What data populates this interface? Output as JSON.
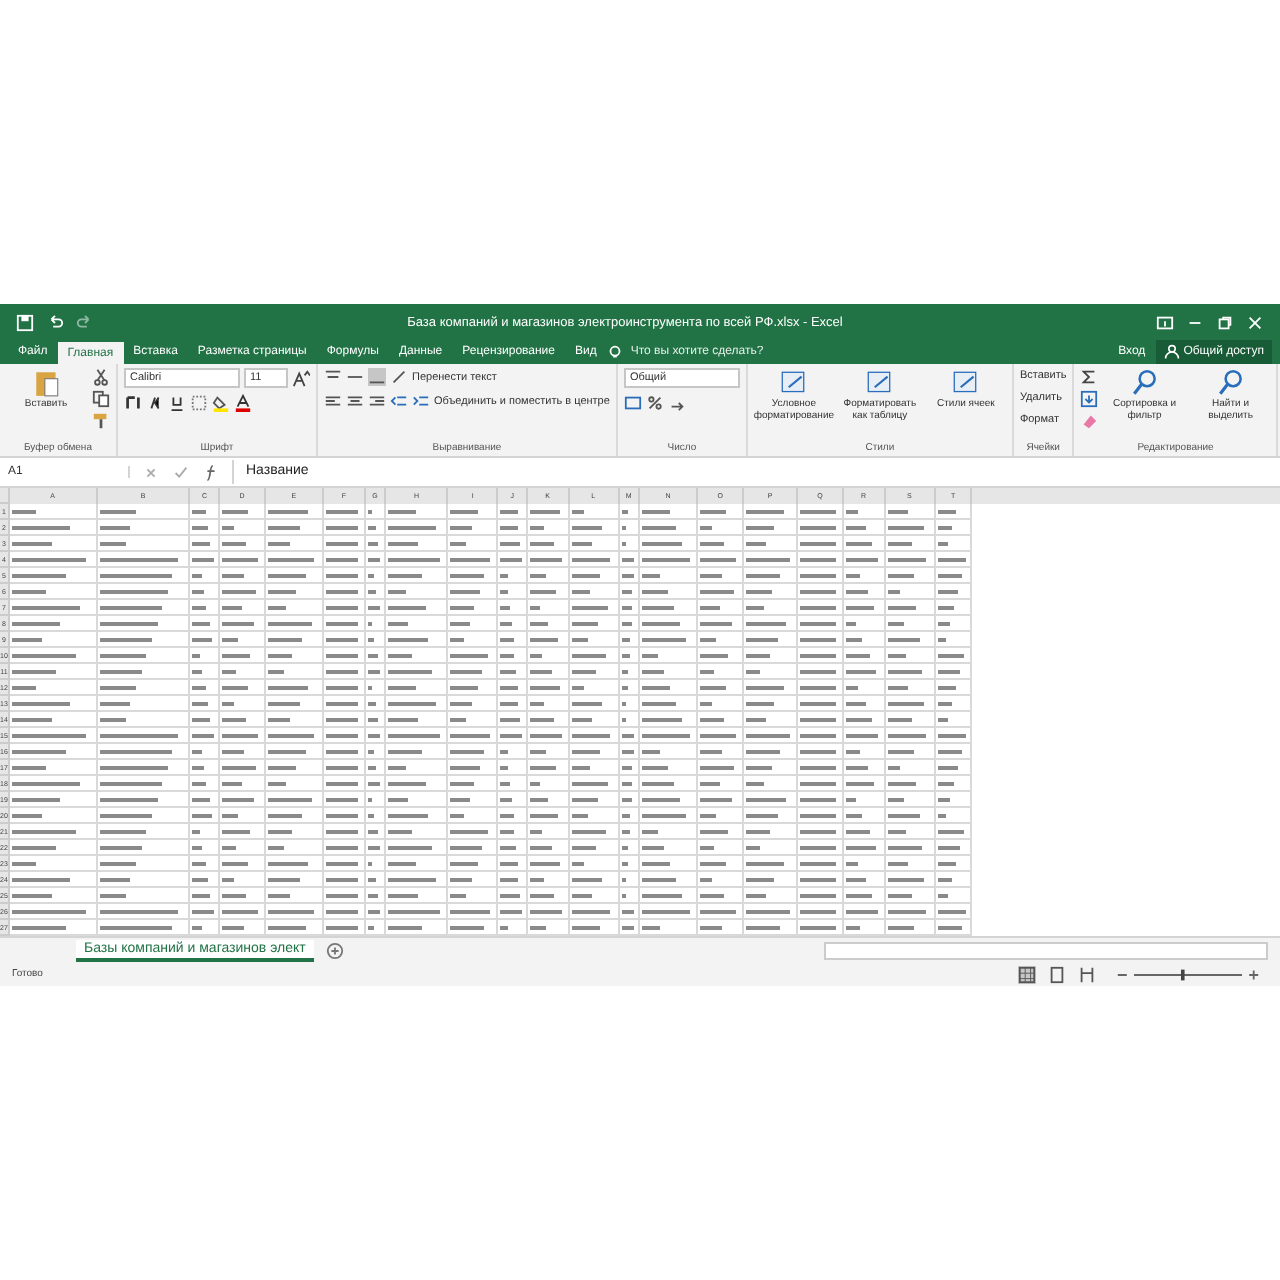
{
  "window": {
    "title": "База компаний и магазинов электроинструмента по всей РФ.xlsx - Excel"
  },
  "menu_tabs": [
    {
      "label": "Файл",
      "selected": false
    },
    {
      "label": "Главная",
      "selected": true
    },
    {
      "label": "Вставка",
      "selected": false
    },
    {
      "label": "Разметка страницы",
      "selected": false
    },
    {
      "label": "Формулы",
      "selected": false
    },
    {
      "label": "Данные",
      "selected": false
    },
    {
      "label": "Рецензирование",
      "selected": false
    },
    {
      "label": "Вид",
      "selected": false
    }
  ],
  "tell_me": {
    "placeholder": "Что вы хотите сделать?"
  },
  "sign_in": "Вход",
  "share": "Общий доступ",
  "ribbon": {
    "paste": "Вставить",
    "font": "Calibri",
    "font_size": "11",
    "wrap_text": "Перенести текст",
    "merge": "Объединить и поместить в центре",
    "number_format": "Общий",
    "style_buttons": [
      "Условное форматирование",
      "Форматировать как таблицу",
      "Стили ячеек"
    ],
    "cell_buttons": [
      "Вставить",
      "Удалить",
      "Формат"
    ],
    "edit_buttons": [
      "Сортировка и фильтр",
      "Найти и выделить"
    ],
    "groups": [
      "Буфер обмена",
      "Шрифт",
      "Выравнивание",
      "Число",
      "Стили",
      "Ячейки",
      "Редактирование"
    ]
  },
  "name_box": "A1",
  "formula": "Название",
  "sheet": {
    "columns": [
      "A",
      "B",
      "C",
      "D",
      "E",
      "F",
      "G",
      "H",
      "I",
      "J",
      "K",
      "L",
      "M",
      "N",
      "O",
      "P",
      "Q",
      "R",
      "S",
      "T"
    ],
    "rows": [
      "1",
      "2",
      "3",
      "4",
      "5",
      "6",
      "7",
      "8",
      "9",
      "10",
      "11",
      "12",
      "13",
      "14",
      "15",
      "16",
      "17",
      "18",
      "19",
      "20",
      "21",
      "22",
      "23",
      "24",
      "25",
      "26",
      "27"
    ]
  },
  "sheet_tab": "Базы компаний и магазинов элект",
  "status": "Готово",
  "zoom": {
    "level": 0.45
  }
}
